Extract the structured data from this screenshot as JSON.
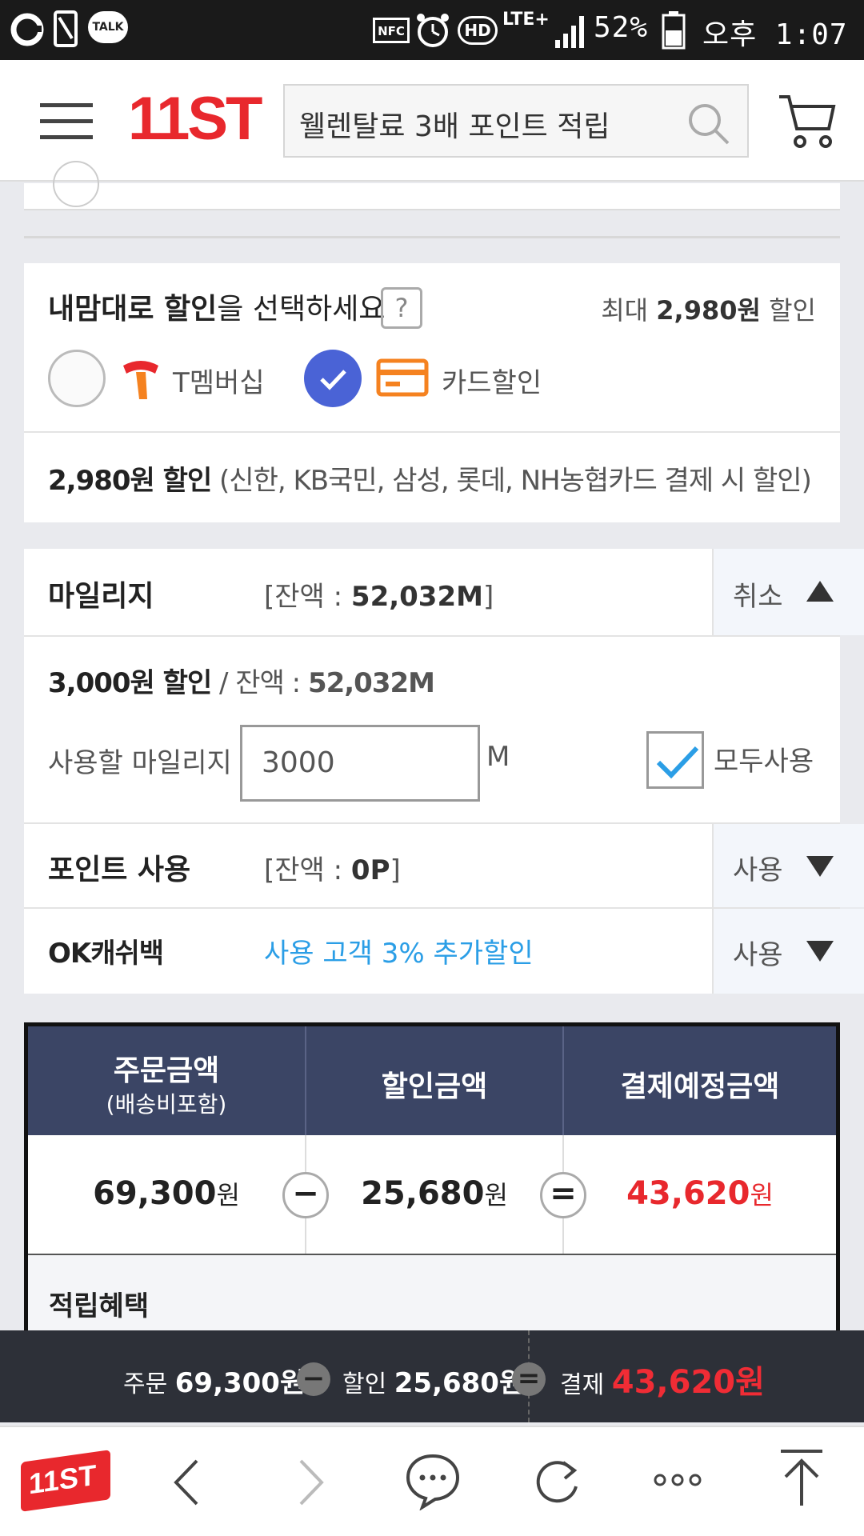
{
  "status_bar": {
    "left_icons": [
      "notification-o-icon",
      "phone-card-icon",
      "kakaotalk-icon"
    ],
    "talk_label": "TALK",
    "right_icons": [
      "nfc-icon",
      "alarm-icon",
      "hd-icon",
      "lte-icon",
      "signal-icon",
      "battery-icon"
    ],
    "nfc_label": "NFC",
    "hd_label": "HD",
    "lte_label": "LTE+",
    "battery": "52%",
    "time": "오후 1:07"
  },
  "header": {
    "logo": "11ST",
    "search_value": "웰렌탈료 3배 포인트 적립"
  },
  "discount": {
    "title_a": "내맘대로 할인",
    "title_b": "을 선택하세요",
    "help": "?",
    "max_label": "최대 ",
    "max_value": "2,980원",
    "max_suffix": " 할인",
    "option_tmembership": "T멤버십",
    "option_card": "카드할인",
    "card_discount_bold": "2,980원 할인",
    "card_discount_note": " (신한, KB국민, 삼성, 롯데, NH농협카드 결제 시 할인)"
  },
  "mileage": {
    "label": "마일리지",
    "balance_prefix": "[잔액 : ",
    "balance_value": "52,032M",
    "balance_suffix": "]",
    "action": "취소",
    "applied_bold": "3,000원 할인",
    "applied_rest": " / 잔액 : ",
    "applied_balance": "52,032M",
    "use_label": "사용할 마일리지",
    "input_value": "3000",
    "unit": "M",
    "use_all": "모두사용"
  },
  "point": {
    "label": "포인트 사용",
    "balance_prefix": "[잔액 : ",
    "balance_value": "0P",
    "balance_suffix": "]",
    "action": "사용"
  },
  "okcashbag": {
    "label": "OK캐쉬백",
    "promo": "사용 고객 3% 추가할인",
    "action": "사용"
  },
  "summary": {
    "col1_title": "주문금액",
    "col1_sub": "(배송비포함)",
    "col2_title": "할인금액",
    "col3_title": "결제예정금액",
    "order_amount": "69,300",
    "discount_amount": "25,680",
    "pay_amount": "43,620",
    "won": "원",
    "minus": "−",
    "equals": "=",
    "reward_label": "적립혜택"
  },
  "paybar": {
    "order_label": "주문",
    "order_value": "69,300원",
    "discount_label": "할인",
    "discount_value": "25,680원",
    "pay_label": "결제",
    "pay_value": "43,620원"
  },
  "bottom_nav": {
    "logo": "11ST"
  },
  "colors": {
    "brand_red": "#e8282d",
    "header_navy": "#3b4565",
    "promo_blue": "#2b9ee6",
    "check_blue": "#4a63d6",
    "card_orange": "#f58220"
  }
}
